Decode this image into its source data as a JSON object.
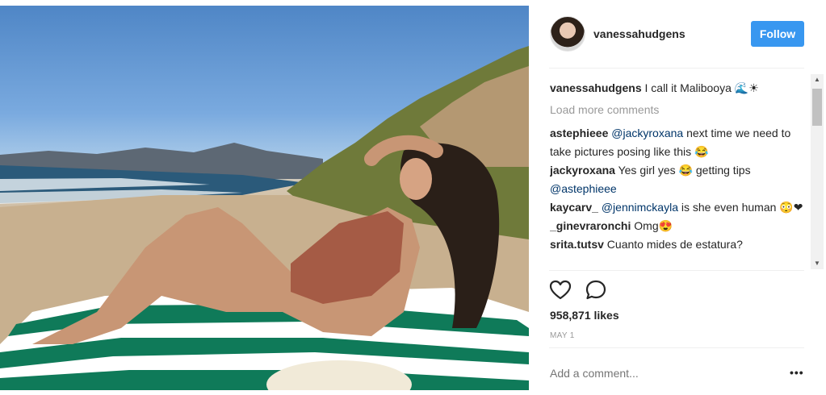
{
  "post": {
    "photo_alt": "",
    "username": "vanessahudgens",
    "follow_label": "Follow",
    "caption": {
      "user": "vanessahudgens",
      "text": " I call it Malibooya 🌊☀"
    },
    "load_more": "Load more comments",
    "comments": [
      {
        "user": "astephieee",
        "mention": "@jackyroxana",
        "text": " next time we need to take pictures posing like this 😂"
      },
      {
        "user": "jackyroxana",
        "mention": "",
        "text": " Yes girl yes 😂 getting tips ",
        "mention2": "@astephieee"
      },
      {
        "user": "kaycarv_",
        "mention": "@jennimckayla",
        "text": " is she even human 😳❤"
      },
      {
        "user": "_ginevraronchi",
        "mention": "",
        "text": " Omg😍"
      },
      {
        "user": "srita.tutsv",
        "mention": "",
        "text": " Cuanto mides de estatura?"
      }
    ],
    "likes": "958,871 likes",
    "date": "MAY 1",
    "add_comment_placeholder": "Add a comment...",
    "more_label": "•••"
  },
  "icons": {
    "like": "heart-icon",
    "comment": "speech-bubble-icon",
    "scroll_up": "▲",
    "scroll_down": "▼"
  },
  "colors": {
    "follow_bg": "#3897f0",
    "mention": "#003569",
    "muted": "#999999"
  }
}
